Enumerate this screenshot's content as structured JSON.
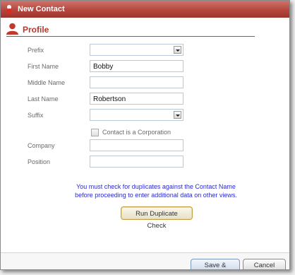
{
  "window": {
    "title": "New Contact",
    "accent_color": "#b5473e"
  },
  "section": {
    "title": "Profile",
    "icon": "person-icon"
  },
  "form": {
    "prefix": {
      "label": "Prefix",
      "value": ""
    },
    "first_name": {
      "label": "First Name",
      "value": "Bobby"
    },
    "middle_name": {
      "label": "Middle Name",
      "value": ""
    },
    "last_name": {
      "label": "Last Name",
      "value": "Robertson"
    },
    "suffix": {
      "label": "Suffix",
      "value": ""
    },
    "is_corporation": {
      "label": "Contact is a Corporation",
      "checked": false
    },
    "company": {
      "label": "Company",
      "value": ""
    },
    "position": {
      "label": "Position",
      "value": ""
    }
  },
  "notice": {
    "line1": "You must check for duplicates against the Contact Name",
    "line2": "before proceeding to enter additional data on other views."
  },
  "buttons": {
    "duplicate_check": "Run Duplicate Check",
    "save_close": "Save & Close",
    "cancel": "Cancel"
  }
}
